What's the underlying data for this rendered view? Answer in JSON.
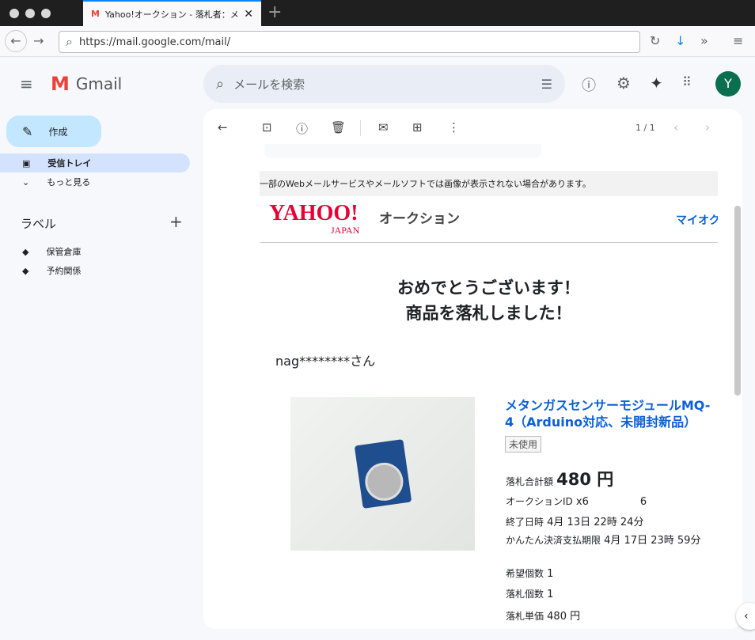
{
  "browser": {
    "tab_title": "Yahoo!オークション - 落札者：メタンガス",
    "url": "https://mail.google.com/mail/"
  },
  "gmail": {
    "brand": "Gmail",
    "search_placeholder": "メールを検索",
    "avatar": "Y",
    "compose": "作成",
    "nav": [
      {
        "label": "受信トレイ"
      },
      {
        "label": "もっと見る"
      }
    ],
    "labels_title": "ラベル",
    "labels": [
      "保管倉庫",
      "予約関係"
    ],
    "pager": "1 / 1"
  },
  "email": {
    "notice": "一部のWebメールサービスやメールソフトでは画像が表示されない場合があります。",
    "logo_text": "YAHOO!",
    "logo_sub": "JAPAN",
    "service": "オークション",
    "myauc": "マイオク",
    "headline1": "おめでとうございます！",
    "headline2": "商品を落札しました！",
    "greeting": "nag********さん",
    "item_title": "メタンガスセンサーモジュールMQ-4（Arduino対応、未開封新品）",
    "condition": "未使用",
    "details": [
      {
        "label": "落札合計額",
        "value": "480 円"
      },
      {
        "label": "オークションID",
        "value": "x6　　　　　6"
      },
      {
        "label": "終了日時",
        "value": "4月 13日 22時 24分"
      },
      {
        "label": "かんたん決済支払期限",
        "value": "4月 17日 23時 59分"
      },
      {
        "label": "希望個数",
        "value": "1"
      },
      {
        "label": "落札個数",
        "value": "1"
      },
      {
        "label": "落札単価",
        "value": "480 円"
      }
    ]
  }
}
